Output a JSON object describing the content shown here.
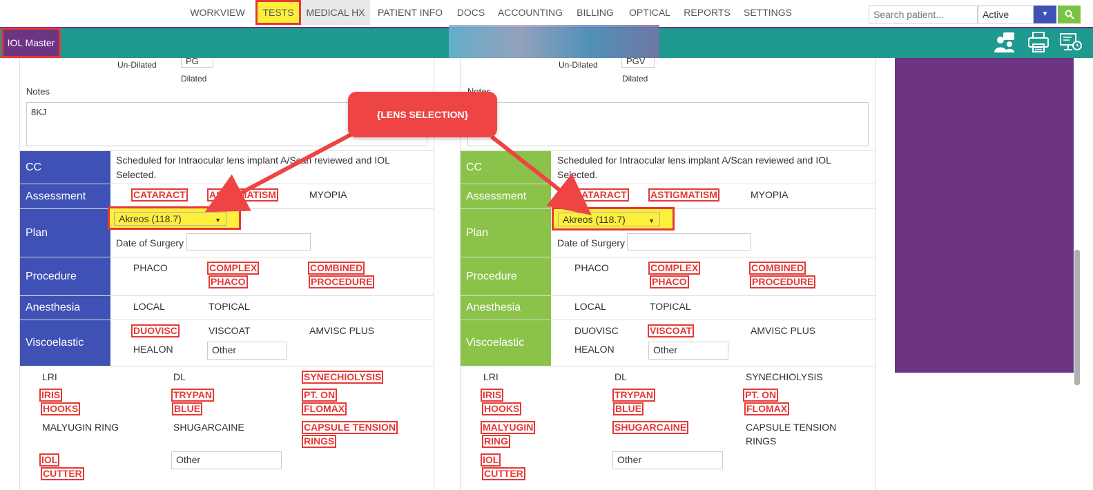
{
  "nav": {
    "items": [
      "WORKVIEW",
      "TESTS",
      "MEDICAL HX",
      "PATIENT INFO",
      "DOCS",
      "ACCOUNTING",
      "BILLING",
      "OPTICAL",
      "REPORTS",
      "SETTINGS"
    ],
    "search_placeholder": "Search patient...",
    "status_value": "Active"
  },
  "tealbar": {
    "title": "IOL Master"
  },
  "callout": {
    "text": "{LENS SELECTION}"
  },
  "colors": {
    "left_label_bg": "#3f51b5",
    "right_label_bg": "#8bc34a",
    "highlight": "#e53935",
    "teal": "#1e9a8f",
    "purple": "#6c3483"
  },
  "left": {
    "undilated_label": "Un-Dilated",
    "dilated_label": "Dilated",
    "top_value": "PG",
    "notes_label": "Notes",
    "notes_value": "8KJ",
    "cc_label": "CC",
    "cc_text": "Scheduled for Intraocular lens implant A/Scan reviewed and IOL Selected.",
    "assessment_label": "Assessment",
    "assessment": [
      "CATARACT",
      "ASTIGMATISM",
      "MYOPIA"
    ],
    "plan_label": "Plan",
    "plan_value": "Akreos (118.7)",
    "date_of_surgery_label": "Date of Surgery",
    "procedure_label": "Procedure",
    "procedure": [
      "PHACO",
      "COMPLEX",
      "PHACO",
      "COMBINED",
      "PROCEDURE"
    ],
    "anesthesia_label": "Anesthesia",
    "anesthesia": [
      "LOCAL",
      "TOPICAL"
    ],
    "viscoelastic_label": "Viscoelastic",
    "viscoelastic": [
      "DUOVISC",
      "VISCOAT",
      "AMVISC PLUS",
      "HEALON"
    ],
    "visco_other": "Other",
    "extras": [
      "LRI",
      "DL",
      "SYNECHIOLYSIS",
      "IRIS",
      "HOOKS",
      "TRYPAN",
      "BLUE",
      "PT. ON",
      "FLOMAX",
      "MALYUGIN RING",
      "SHUGARCAINE",
      "CAPSULE TENSION",
      "RINGS",
      "IOL",
      "CUTTER"
    ],
    "extras_other": "Other"
  },
  "right": {
    "undilated_label": "Un-Dilated",
    "dilated_label": "Dilated",
    "top_value": "PGV",
    "notes_label": "Notes",
    "cc_label": "CC",
    "cc_text": "Scheduled for Intraocular lens implant A/Scan reviewed and IOL Selected.",
    "assessment_label": "Assessment",
    "assessment": [
      "CATARACT",
      "ASTIGMATISM",
      "MYOPIA"
    ],
    "plan_label": "Plan",
    "plan_value": "Akreos (118.7)",
    "date_of_surgery_label": "Date of Surgery",
    "procedure_label": "Procedure",
    "procedure": [
      "PHACO",
      "COMPLEX",
      "PHACO",
      "COMBINED",
      "PROCEDURE"
    ],
    "anesthesia_label": "Anesthesia",
    "anesthesia": [
      "LOCAL",
      "TOPICAL"
    ],
    "viscoelastic_label": "Viscoelastic",
    "viscoelastic": [
      "DUOVISC",
      "VISCOAT",
      "AMVISC PLUS",
      "HEALON"
    ],
    "visco_other": "Other",
    "extras": [
      "LRI",
      "DL",
      "SYNECHIOLYSIS",
      "IRIS",
      "HOOKS",
      "TRYPAN",
      "BLUE",
      "PT. ON",
      "FLOMAX",
      "MALYUGIN",
      "RING",
      "SHUGARCAINE",
      "CAPSULE TENSION",
      "RINGS",
      "IOL",
      "CUTTER"
    ],
    "extras_other": "Other"
  }
}
